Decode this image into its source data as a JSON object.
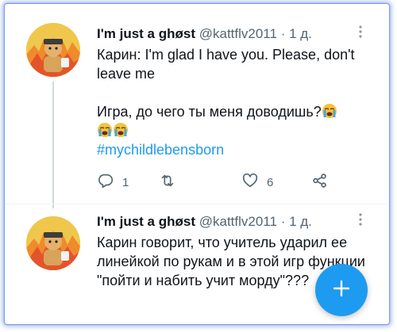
{
  "tweets": [
    {
      "display_name": "I'm just a ghøst",
      "handle": "@kattflv2011",
      "time": "· 1 д.",
      "text_line1": "Карин: I'm glad I have you. Please, don't leave me",
      "text_line2": "Игра, до чего ты меня доводишь?",
      "hashtag": "#mychildlebensborn",
      "reply_count": "1",
      "retweet_count": "",
      "like_count": "6",
      "emoji_name": "loudly-crying-face-emoji"
    },
    {
      "display_name": "I'm just a ghøst",
      "handle": "@kattflv2011",
      "time": "· 1 д.",
      "text": "Карин говорит, что учитель ударил ее линейкой по рукам и в этой игр функции \"пойти и набить учит морду\"???"
    }
  ],
  "icons": {
    "more": "more-horizontal-icon",
    "reply": "reply-icon",
    "retweet": "retweet-icon",
    "like": "heart-icon",
    "share": "share-icon",
    "compose": "plus-icon"
  },
  "colors": {
    "accent": "#1d9bf0",
    "text": "#0f1419",
    "secondary": "#536471"
  }
}
